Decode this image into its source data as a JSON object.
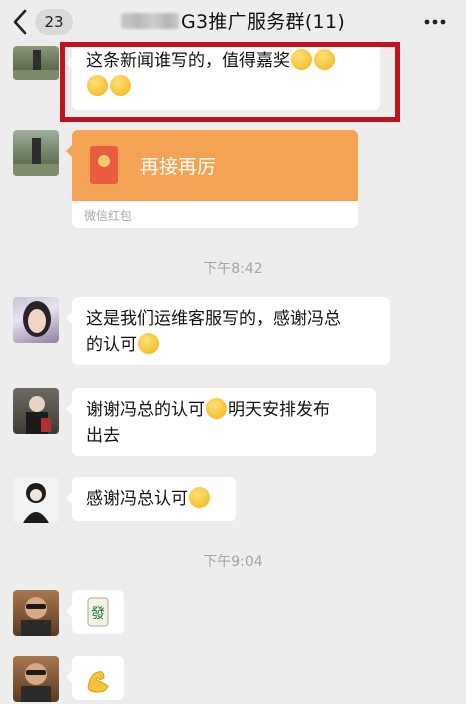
{
  "header": {
    "back_badge": "23",
    "title": "G3推广服务群(11)"
  },
  "messages": [
    {
      "kind": "text",
      "text": "这条新闻谁写的，值得嘉奖",
      "emojis": [
        "grin-emoji",
        "thinking-emoji",
        "grin-emoji",
        "grin-emoji"
      ]
    },
    {
      "kind": "red_packet",
      "label": "再接再厉",
      "footer": "微信红包"
    },
    {
      "kind": "time",
      "text": "下午8:42"
    },
    {
      "kind": "text",
      "line1": "这是我们运维客服写的，感谢冯总",
      "line2": "的认可",
      "emojis": [
        "tongue-wink-emoji"
      ]
    },
    {
      "kind": "text",
      "line1": "谢谢冯总的认可",
      "line1b": "明天安排发布",
      "line2": "出去",
      "emojis": [
        "smile-emoji"
      ]
    },
    {
      "kind": "text",
      "text": "感谢冯总认可",
      "emojis": [
        "smile-emoji"
      ]
    },
    {
      "kind": "time",
      "text": "下午9:04"
    },
    {
      "kind": "sticker",
      "icon": "mahjong-tile-icon",
      "glyph": "發"
    },
    {
      "kind": "sticker",
      "icon": "flexed-biceps-icon",
      "glyph": "💪"
    }
  ],
  "colors": {
    "background": "#ededed",
    "bubble": "#ffffff",
    "red_packet": "#f3a353",
    "highlight_box": "#c1121f",
    "timestamp": "#a3a3a3"
  }
}
